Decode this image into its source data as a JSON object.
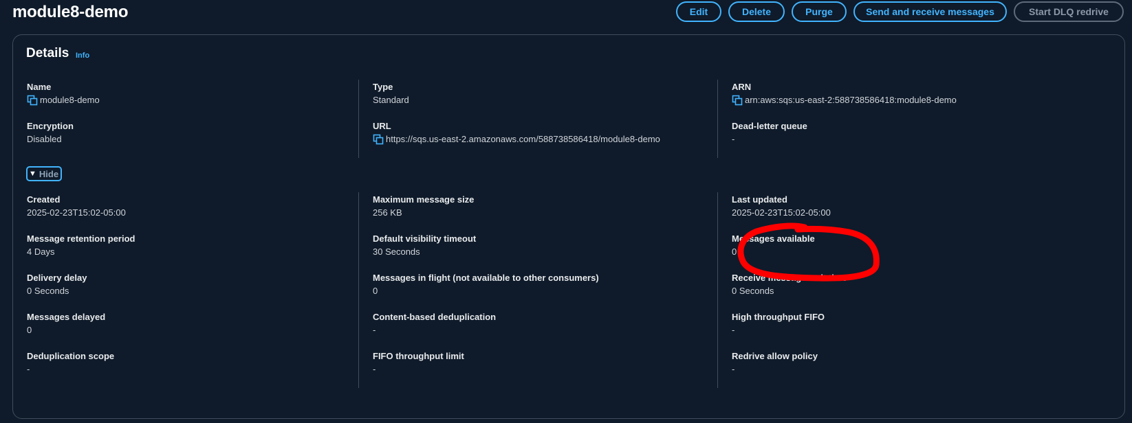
{
  "header": {
    "title": "module8-demo",
    "actions": {
      "edit": "Edit",
      "delete": "Delete",
      "purge": "Purge",
      "send_receive": "Send and receive messages",
      "dlq_redrive": "Start DLQ redrive"
    }
  },
  "details": {
    "title": "Details",
    "info": "Info",
    "name": {
      "label": "Name",
      "value": "module8-demo"
    },
    "type": {
      "label": "Type",
      "value": "Standard"
    },
    "arn": {
      "label": "ARN",
      "value": "arn:aws:sqs:us-east-2:588738586418:module8-demo"
    },
    "encryption": {
      "label": "Encryption",
      "value": "Disabled"
    },
    "url": {
      "label": "URL",
      "value": "https://sqs.us-east-2.amazonaws.com/588738586418/module8-demo"
    },
    "dlq": {
      "label": "Dead-letter queue",
      "value": "-"
    },
    "toggle": "Hide",
    "created": {
      "label": "Created",
      "value": "2025-02-23T15:02-05:00"
    },
    "max_size": {
      "label": "Maximum message size",
      "value": "256 KB"
    },
    "last_updated": {
      "label": "Last updated",
      "value": "2025-02-23T15:02-05:00"
    },
    "retention": {
      "label": "Message retention period",
      "value": "4 Days"
    },
    "visibility": {
      "label": "Default visibility timeout",
      "value": "30 Seconds"
    },
    "available": {
      "label": "Messages available",
      "value": "0"
    },
    "delivery_delay": {
      "label": "Delivery delay",
      "value": "0 Seconds"
    },
    "in_flight": {
      "label": "Messages in flight (not available to other consumers)",
      "value": "0"
    },
    "wait_time": {
      "label": "Receive message wait time",
      "value": "0 Seconds"
    },
    "delayed": {
      "label": "Messages delayed",
      "value": "0"
    },
    "content_dedup": {
      "label": "Content-based deduplication",
      "value": "-"
    },
    "high_throughput": {
      "label": "High throughput FIFO",
      "value": "-"
    },
    "dedup_scope": {
      "label": "Deduplication scope",
      "value": "-"
    },
    "fifo_limit": {
      "label": "FIFO throughput limit",
      "value": "-"
    },
    "redrive_allow": {
      "label": "Redrive allow policy",
      "value": "-"
    }
  },
  "colors": {
    "background": "#0f1b2a",
    "accent": "#42b4ff",
    "annotation": "#ff0000"
  },
  "icons": [
    "copy-icon",
    "caret-down-icon"
  ]
}
